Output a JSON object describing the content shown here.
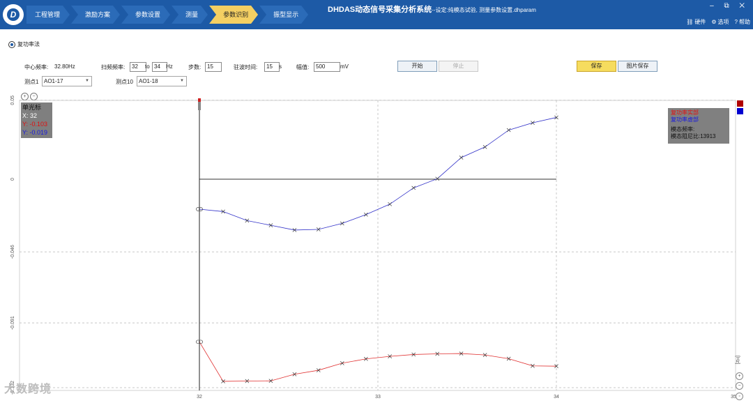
{
  "header": {
    "steps": [
      "工程管理",
      "激励方案",
      "参数设置",
      "测量",
      "参数识别",
      "振型显示"
    ],
    "active_step": 4,
    "app_title": "DHDAS动态信号采集分析系统",
    "app_subtitle": "--设定:纯模态试验, 测量参数设置.dhparam",
    "window_controls": "– ⧉ ✕",
    "menu": [
      {
        "icon": "hardware-icon",
        "label": "硬件"
      },
      {
        "icon": "gear-icon",
        "label": "选项"
      },
      {
        "icon": "help-icon",
        "label": "帮助"
      }
    ]
  },
  "method": {
    "label": "复功率法",
    "selected": true
  },
  "params": {
    "center_freq_label": "中心频率:",
    "center_freq_value": "32.80Hz",
    "sweep_label": "扫频频率:",
    "sweep_from": "32",
    "sweep_to_label": "to",
    "sweep_to": "34",
    "sweep_unit": "Hz",
    "step_label": "步数:",
    "step_value": "15",
    "dwell_label": "驻波时间:",
    "dwell_value": "15",
    "dwell_unit": "s",
    "amp_label": "幅值:",
    "amp_value": "500",
    "amp_unit": "mV"
  },
  "buttons": {
    "start": "开始",
    "stop": "停止",
    "save": "保存",
    "save_image": "图片保存"
  },
  "points": {
    "p1_label": "测点1",
    "p1_value": "AO1-17",
    "p10_label": "测点10",
    "p10_value": "AO1-18"
  },
  "cursor": {
    "title": "单光标",
    "x": "X: 32",
    "y1": "Y: -0.103",
    "y2": "Y: -0.019"
  },
  "legend": {
    "real": "复功率实部",
    "imag": "复功率虚部",
    "modal_freq_label": "模态频率:",
    "modal_damp_label": "模态阻尼比:",
    "modal_value": "13913"
  },
  "side_labels": {
    "hz": "[Hz]"
  },
  "watermark": "大数跨境",
  "colors": {
    "real": "#e03030",
    "imag": "#3030c8",
    "header": "#1d5aa6",
    "active_step": "#f4cf62"
  },
  "chart_data": {
    "type": "line",
    "xlim": [
      32,
      35
    ],
    "ylim": [
      -0.132,
      0.05
    ],
    "x_ticks": [
      "32",
      "33",
      "34",
      "35"
    ],
    "y_ticks": [
      "0.05",
      "0",
      "-0.046",
      "-0.091",
      "-0.132"
    ],
    "grid": true,
    "legend": "top-right",
    "x": [
      32.0,
      32.133,
      32.267,
      32.4,
      32.533,
      32.667,
      32.8,
      32.933,
      33.067,
      33.2,
      33.333,
      33.467,
      33.6,
      33.733,
      33.867,
      34.0
    ],
    "series": [
      {
        "name": "复功率实部",
        "color": "#e03030",
        "values": [
          -0.103,
          -0.128,
          -0.1278,
          -0.1277,
          -0.1235,
          -0.121,
          -0.1165,
          -0.1138,
          -0.1122,
          -0.111,
          -0.1106,
          -0.1104,
          -0.1113,
          -0.1137,
          -0.1182,
          -0.1184
        ]
      },
      {
        "name": "复功率虚部",
        "color": "#3030c8",
        "values": [
          -0.019,
          -0.0205,
          -0.0262,
          -0.0292,
          -0.0322,
          -0.0318,
          -0.028,
          -0.0224,
          -0.0158,
          -0.0055,
          0.0003,
          0.0137,
          0.0204,
          0.0311,
          0.0357,
          0.0391
        ]
      }
    ]
  }
}
